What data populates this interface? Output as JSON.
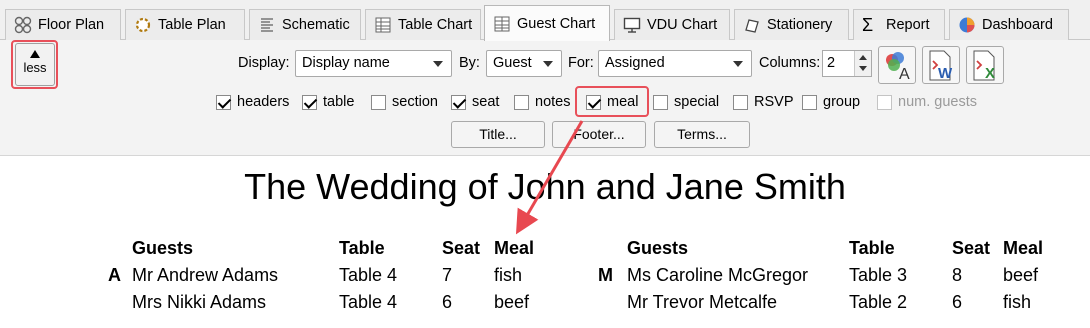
{
  "tabs": [
    {
      "label": "Floor Plan",
      "icon": "floor-plan-icon"
    },
    {
      "label": "Table Plan",
      "icon": "table-plan-icon"
    },
    {
      "label": "Schematic",
      "icon": "schematic-icon"
    },
    {
      "label": "Table Chart",
      "icon": "table-chart-icon"
    },
    {
      "label": "Guest Chart",
      "icon": "guest-chart-icon",
      "active": true
    },
    {
      "label": "VDU Chart",
      "icon": "monitor-icon"
    },
    {
      "label": "Stationery",
      "icon": "stationery-icon"
    },
    {
      "label": "Report",
      "icon": "sigma-icon"
    },
    {
      "label": "Dashboard",
      "icon": "pie-chart-icon"
    }
  ],
  "toolbar": {
    "less_label": "less",
    "display_label": "Display:",
    "display_value": "Display name",
    "by_label": "By:",
    "by_value": "Guest",
    "for_label": "For:",
    "for_value": "Assigned",
    "columns_label": "Columns:",
    "columns_value": "2",
    "icon_buttons": [
      "font-color-icon",
      "export-word-icon",
      "export-excel-icon"
    ]
  },
  "checkboxes": [
    {
      "label": "headers",
      "checked": true
    },
    {
      "label": "table",
      "checked": true
    },
    {
      "label": "section",
      "checked": false
    },
    {
      "label": "seat",
      "checked": true
    },
    {
      "label": "notes",
      "checked": false
    },
    {
      "label": "meal",
      "checked": true
    },
    {
      "label": "special",
      "checked": false
    },
    {
      "label": "RSVP",
      "checked": false
    },
    {
      "label": "group",
      "checked": false
    },
    {
      "label": "num. guests",
      "checked": false,
      "disabled": true
    }
  ],
  "buttons": {
    "title": "Title...",
    "footer": "Footer...",
    "terms": "Terms..."
  },
  "document": {
    "title": "The Wedding of John and Jane Smith",
    "headers": [
      "Guests",
      "Table",
      "Seat",
      "Meal"
    ],
    "left": {
      "letter": "A",
      "rows": [
        {
          "guest": "Mr Andrew Adams",
          "table": "Table 4",
          "seat": "7",
          "meal": "fish"
        },
        {
          "guest": "Mrs Nikki Adams",
          "table": "Table 4",
          "seat": "6",
          "meal": "beef"
        }
      ]
    },
    "right": {
      "letter": "M",
      "rows": [
        {
          "guest": "Ms Caroline McGregor",
          "table": "Table 3",
          "seat": "8",
          "meal": "beef"
        },
        {
          "guest": "Mr Trevor Metcalfe",
          "table": "Table 2",
          "seat": "6",
          "meal": "fish"
        }
      ]
    }
  },
  "colors": {
    "highlight": "#e8505a",
    "arrow": "#e84850"
  }
}
